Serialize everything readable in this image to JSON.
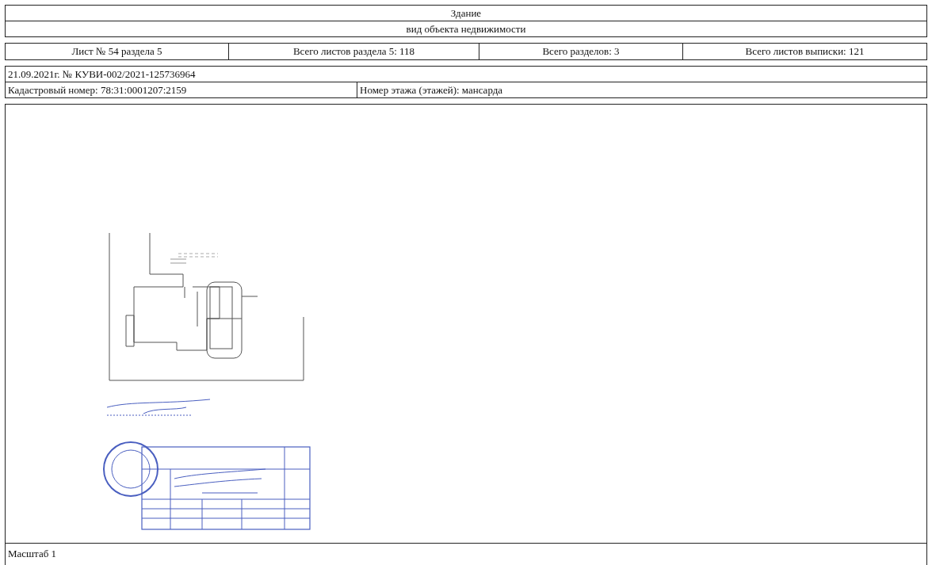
{
  "header": {
    "object_type": "Здание",
    "object_type_caption": "вид объекта недвижимости"
  },
  "sheet_info": [
    "Лист № 54 раздела 5",
    "Всего листов раздела 5: 118",
    "Всего разделов: 3",
    "Всего листов выписки: 121"
  ],
  "statement": {
    "date_number": "21.09.2021г. № КУВИ-002/2021-125736964",
    "cadastral_number": "Кадастровый номер: 78:31:0001207:2159",
    "floor": "Номер этажа (этажей): мансарда"
  },
  "plan": {
    "scale": "Масштаб 1"
  }
}
